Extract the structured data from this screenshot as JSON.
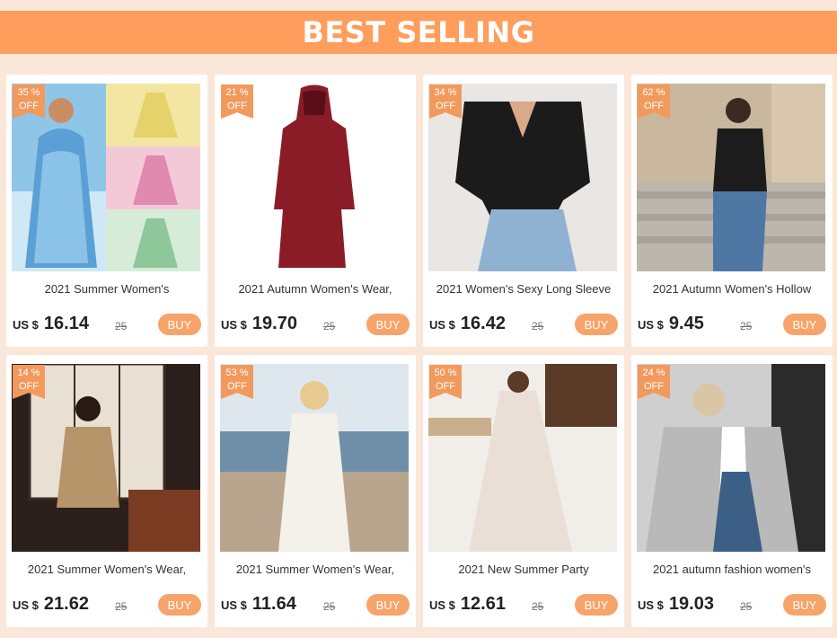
{
  "banner": {
    "title": "BEST SELLING"
  },
  "products": [
    {
      "discount": "35 %",
      "off": "OFF",
      "title": "2021 Summer Women's",
      "currency": "US $",
      "price": "16.14",
      "orig": "25",
      "buy": "BUY"
    },
    {
      "discount": "21 %",
      "off": "OFF",
      "title": "2021 Autumn Women's Wear,",
      "currency": "US $",
      "price": "19.70",
      "orig": "25",
      "buy": "BUY"
    },
    {
      "discount": "34 %",
      "off": "OFF",
      "title": "2021 Women's Sexy Long Sleeve",
      "currency": "US $",
      "price": "16.42",
      "orig": "25",
      "buy": "BUY"
    },
    {
      "discount": "62 %",
      "off": "OFF",
      "title": "2021 Autumn Women's Hollow",
      "currency": "US $",
      "price": "9.45",
      "orig": "25",
      "buy": "BUY"
    },
    {
      "discount": "14 %",
      "off": "OFF",
      "title": "2021 Summer Women's Wear,",
      "currency": "US $",
      "price": "21.62",
      "orig": "25",
      "buy": "BUY"
    },
    {
      "discount": "53 %",
      "off": "OFF",
      "title": "2021 Summer Women's Wear,",
      "currency": "US $",
      "price": "11.64",
      "orig": "25",
      "buy": "BUY"
    },
    {
      "discount": "50 %",
      "off": "OFF",
      "title": "2021 New Summer Party",
      "currency": "US $",
      "price": "12.61",
      "orig": "25",
      "buy": "BUY"
    },
    {
      "discount": "24 %",
      "off": "OFF",
      "title": "2021 autumn fashion women's",
      "currency": "US $",
      "price": "19.03",
      "orig": "25",
      "buy": "BUY"
    }
  ],
  "colors": {
    "banner": "#ff9d5c",
    "badge": "#f29a5d",
    "buy_button": "#f7a46b",
    "page_bg": "#fbe7da"
  }
}
